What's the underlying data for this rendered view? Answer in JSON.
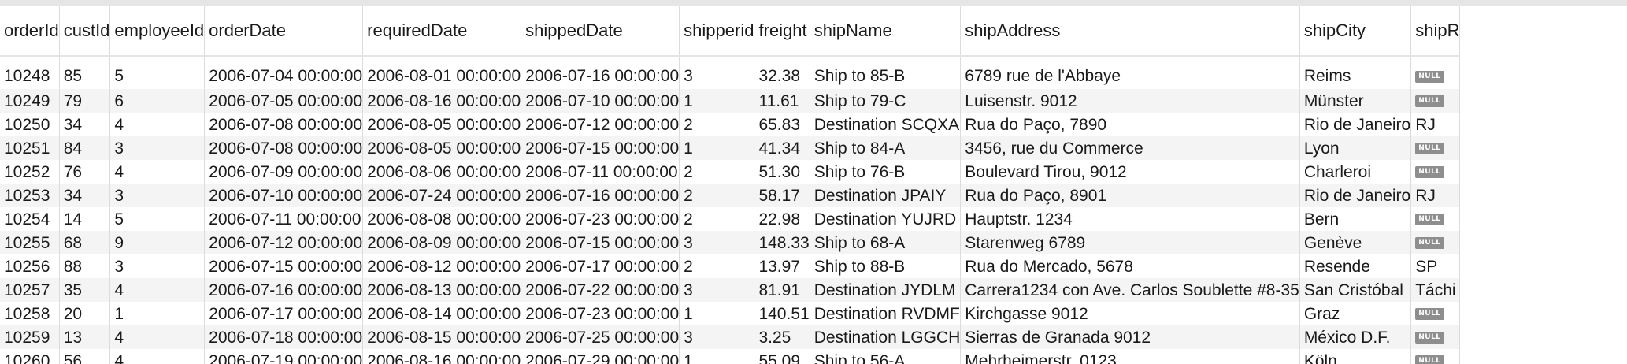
{
  "table": {
    "columns": [
      "orderId",
      "custId",
      "employeeId",
      "orderDate",
      "requiredDate",
      "shippedDate",
      "shipperid",
      "freight",
      "shipName",
      "shipAddress",
      "shipCity",
      "shipR"
    ],
    "null_label": "NULL",
    "rows": [
      [
        "10248",
        "85",
        "5",
        "2006-07-04 00:00:00",
        "2006-08-01 00:00:00",
        "2006-07-16 00:00:00",
        "3",
        "32.38",
        "Ship to 85-B",
        "6789 rue de l'Abbaye",
        "Reims",
        null
      ],
      [
        "10249",
        "79",
        "6",
        "2006-07-05 00:00:00",
        "2006-08-16 00:00:00",
        "2006-07-10 00:00:00",
        "1",
        "11.61",
        "Ship to 79-C",
        "Luisenstr. 9012",
        "Münster",
        null
      ],
      [
        "10250",
        "34",
        "4",
        "2006-07-08 00:00:00",
        "2006-08-05 00:00:00",
        "2006-07-12 00:00:00",
        "2",
        "65.83",
        "Destination SCQXA",
        "Rua do Paço, 7890",
        "Rio de Janeiro",
        "RJ"
      ],
      [
        "10251",
        "84",
        "3",
        "2006-07-08 00:00:00",
        "2006-08-05 00:00:00",
        "2006-07-15 00:00:00",
        "1",
        "41.34",
        "Ship to 84-A",
        "3456, rue du Commerce",
        "Lyon",
        null
      ],
      [
        "10252",
        "76",
        "4",
        "2006-07-09 00:00:00",
        "2006-08-06 00:00:00",
        "2006-07-11 00:00:00",
        "2",
        "51.30",
        "Ship to 76-B",
        "Boulevard Tirou, 9012",
        "Charleroi",
        null
      ],
      [
        "10253",
        "34",
        "3",
        "2006-07-10 00:00:00",
        "2006-07-24 00:00:00",
        "2006-07-16 00:00:00",
        "2",
        "58.17",
        "Destination JPAIY",
        "Rua do Paço, 8901",
        "Rio de Janeiro",
        "RJ"
      ],
      [
        "10254",
        "14",
        "5",
        "2006-07-11 00:00:00",
        "2006-08-08 00:00:00",
        "2006-07-23 00:00:00",
        "2",
        "22.98",
        "Destination YUJRD",
        "Hauptstr. 1234",
        "Bern",
        null
      ],
      [
        "10255",
        "68",
        "9",
        "2006-07-12 00:00:00",
        "2006-08-09 00:00:00",
        "2006-07-15 00:00:00",
        "3",
        "148.33",
        "Ship to 68-A",
        "Starenweg 6789",
        "Genève",
        null
      ],
      [
        "10256",
        "88",
        "3",
        "2006-07-15 00:00:00",
        "2006-08-12 00:00:00",
        "2006-07-17 00:00:00",
        "2",
        "13.97",
        "Ship to 88-B",
        "Rua do Mercado, 5678",
        "Resende",
        "SP"
      ],
      [
        "10257",
        "35",
        "4",
        "2006-07-16 00:00:00",
        "2006-08-13 00:00:00",
        "2006-07-22 00:00:00",
        "3",
        "81.91",
        "Destination JYDLM",
        "Carrera1234 con Ave. Carlos Soublette #8-35",
        "San Cristóbal",
        "Táchi"
      ],
      [
        "10258",
        "20",
        "1",
        "2006-07-17 00:00:00",
        "2006-08-14 00:00:00",
        "2006-07-23 00:00:00",
        "1",
        "140.51",
        "Destination RVDMF",
        "Kirchgasse 9012",
        "Graz",
        null
      ],
      [
        "10259",
        "13",
        "4",
        "2006-07-18 00:00:00",
        "2006-08-15 00:00:00",
        "2006-07-25 00:00:00",
        "3",
        "3.25",
        "Destination LGGCH",
        "Sierras de Granada 9012",
        "México D.F.",
        null
      ],
      [
        "10260",
        "56",
        "4",
        "2006-07-19 00:00:00",
        "2006-08-16 00:00:00",
        "2006-07-29 00:00:00",
        "1",
        "55.09",
        "Ship to 56-A",
        "Mehrheimerstr. 0123",
        "Köln",
        null
      ]
    ]
  }
}
